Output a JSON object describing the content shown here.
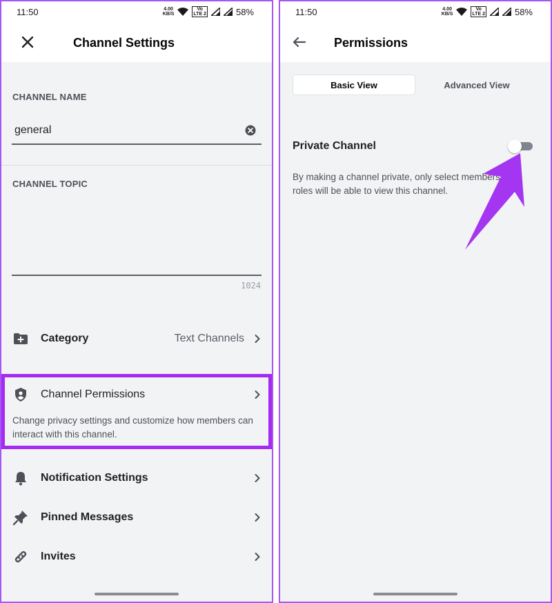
{
  "status_bar": {
    "time": "11:50",
    "net_speed_value": "4.00",
    "net_speed_unit": "KB/S",
    "volte_top": "Vo",
    "volte_bottom": "LTE 2",
    "battery": "58%"
  },
  "channel_settings": {
    "title": "Channel Settings",
    "channel_name_label": "CHANNEL NAME",
    "channel_name_value": "general",
    "channel_topic_label": "CHANNEL TOPIC",
    "topic_counter": "1024",
    "category": {
      "label": "Category",
      "value": "Text Channels"
    },
    "permissions": {
      "label": "Channel Permissions",
      "description": "Change privacy settings and customize how members can interact with this channel."
    },
    "notification_settings": "Notification Settings",
    "pinned_messages": "Pinned Messages",
    "invites": "Invites"
  },
  "permissions_screen": {
    "title": "Permissions",
    "tabs": [
      {
        "label": "Basic View",
        "selected": true
      },
      {
        "label": "Advanced View",
        "selected": false
      }
    ],
    "private_channel": {
      "label": "Private Channel",
      "enabled": false,
      "description": "By making a channel private, only select members and roles will be able to view this channel."
    }
  },
  "colors": {
    "highlight": "#a42bf0",
    "arrow": "#a435f0",
    "frame": "#a855f7"
  },
  "icons": {
    "close": "close-icon",
    "back": "back-arrow-icon",
    "clear": "clear-circle-icon",
    "category": "folder-plus-icon",
    "permissions": "shield-user-icon",
    "notifications": "bell-icon",
    "pinned": "pin-icon",
    "invites": "link-icon",
    "chevron": "chevron-right-icon"
  }
}
